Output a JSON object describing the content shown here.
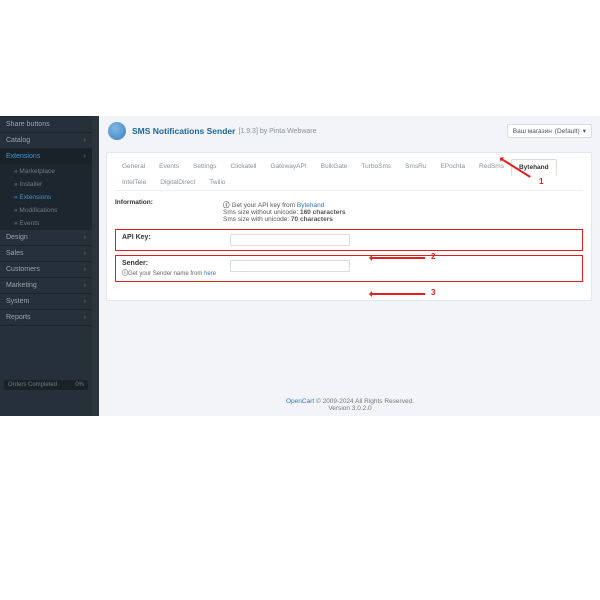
{
  "sidebar": {
    "items": [
      {
        "label": "Share buttons"
      },
      {
        "label": "Catalog"
      },
      {
        "label": "Extensions"
      },
      {
        "label": "Design"
      },
      {
        "label": "Sales"
      },
      {
        "label": "Customers"
      },
      {
        "label": "Marketing"
      },
      {
        "label": "System"
      },
      {
        "label": "Reports"
      }
    ],
    "subs": [
      {
        "label": "Marketplace"
      },
      {
        "label": "Installer"
      },
      {
        "label": "Extensions"
      },
      {
        "label": "Modifications"
      },
      {
        "label": "Events"
      }
    ],
    "bottom_btn": "Orders Completed",
    "bottom_pct": "0%"
  },
  "header": {
    "title": "SMS Notifications Sender",
    "version": "[1.9.3] by Pinta Webware",
    "shop_label": "Ваш магазин",
    "shop_value": "(Default)"
  },
  "tabs": [
    "General",
    "Events",
    "Settings",
    "Clickatell",
    "GatewayAPI",
    "BulkGate",
    "TurboSms",
    "SmsRu",
    "EPochta",
    "RedSms",
    "Bytehand",
    "IntelTele",
    "DigitalDirect",
    "Twilio"
  ],
  "active_tab": 10,
  "info_row": {
    "label": "Information:",
    "line1_pre": "Get your API key from ",
    "line1_link": "Bytehand",
    "line2_pre": "Sms size without unicode: ",
    "line2_val": "160 characters",
    "line3_pre": "Sms size with unicode: ",
    "line3_val": "70 characters"
  },
  "api_row": {
    "label": "API Key:"
  },
  "sender_row": {
    "label": "Sender:",
    "help_pre": "Get your Sender name from ",
    "help_link": "here"
  },
  "annot": {
    "n1": "1",
    "n2": "2",
    "n3": "3"
  },
  "footer": {
    "oc": "OpenCart",
    "copy": " © 2009-2024 All Rights Reserved.",
    "ver": "Version 3.0.2.0"
  }
}
